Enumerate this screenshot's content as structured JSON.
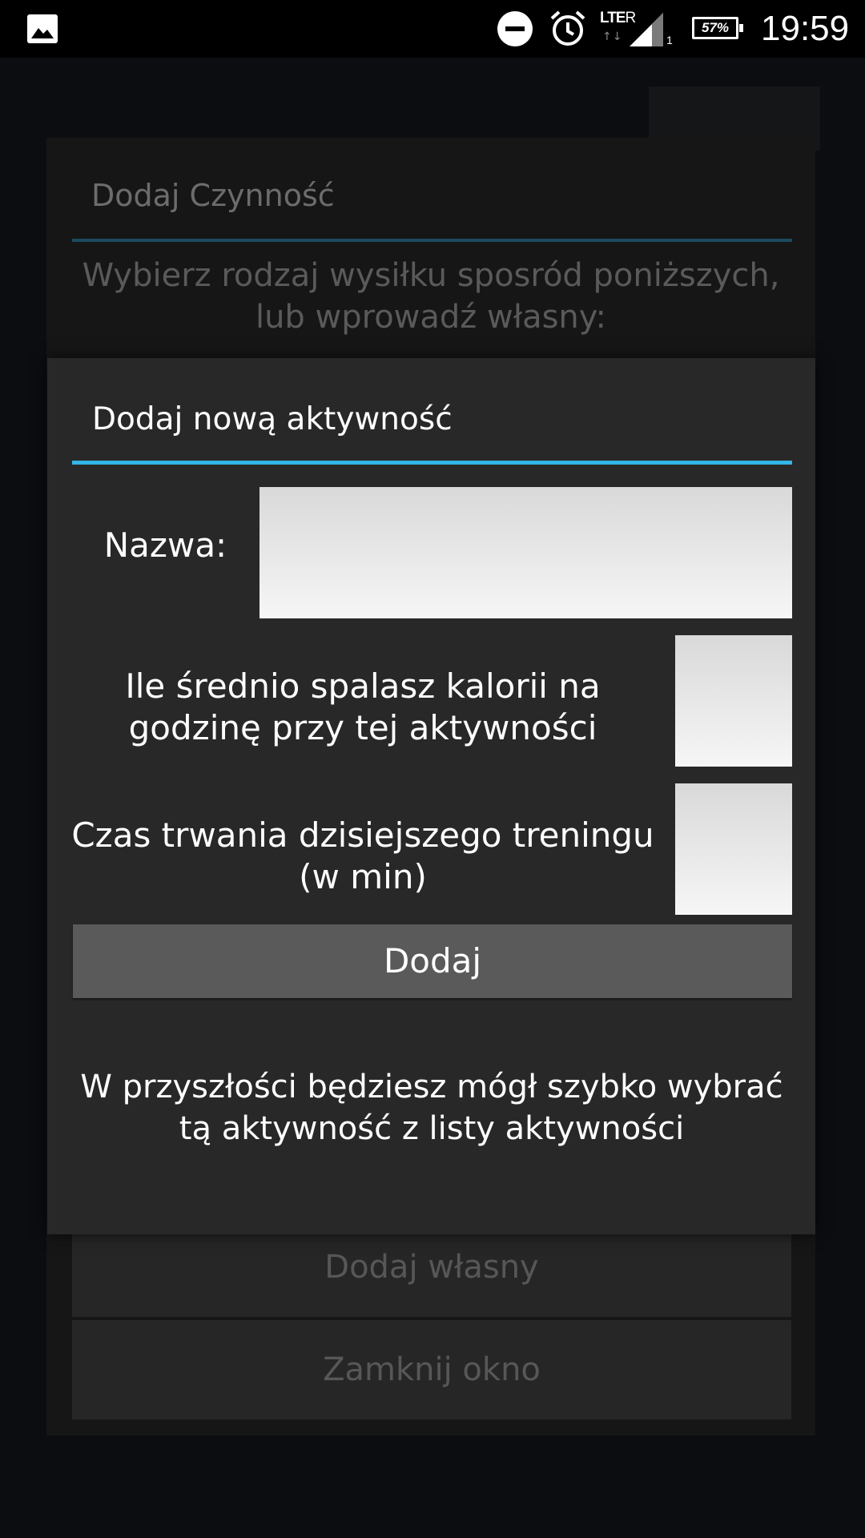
{
  "status_bar": {
    "icons": [
      "gallery-icon",
      "do-not-disturb-icon",
      "alarm-icon",
      "lte-roaming-icon",
      "signal-icon",
      "battery-icon"
    ],
    "network": "LTE",
    "roaming": "R",
    "sim_slot": "1",
    "battery_percent": "57%",
    "battery_level": 0.57,
    "time": "19:59"
  },
  "background_dialog": {
    "title": "Dodaj Czynność",
    "message": "Wybierz rodzaj wysiłku sposród poniższych, lub wprowadź własny:",
    "add_own_label": "Dodaj własny",
    "close_label": "Zamknij okno"
  },
  "dialog": {
    "title": "Dodaj nową aktywność",
    "name_label": "Nazwa:",
    "name_value": "",
    "kcal_label": "Ile średnio spalasz kalorii na godzinę przy tej aktywności",
    "kcal_value": "",
    "duration_label": "Czas trwania dzisiejszego treningu (w min)",
    "duration_value": "",
    "add_button_label": "Dodaj",
    "note": "W przyszłości będziesz mógł szybko wybrać tą aktywność z listy aktywności"
  },
  "colors": {
    "accent": "#33b5e5",
    "dialog_bg": "#282828",
    "button_bg": "#5a5a5a"
  }
}
